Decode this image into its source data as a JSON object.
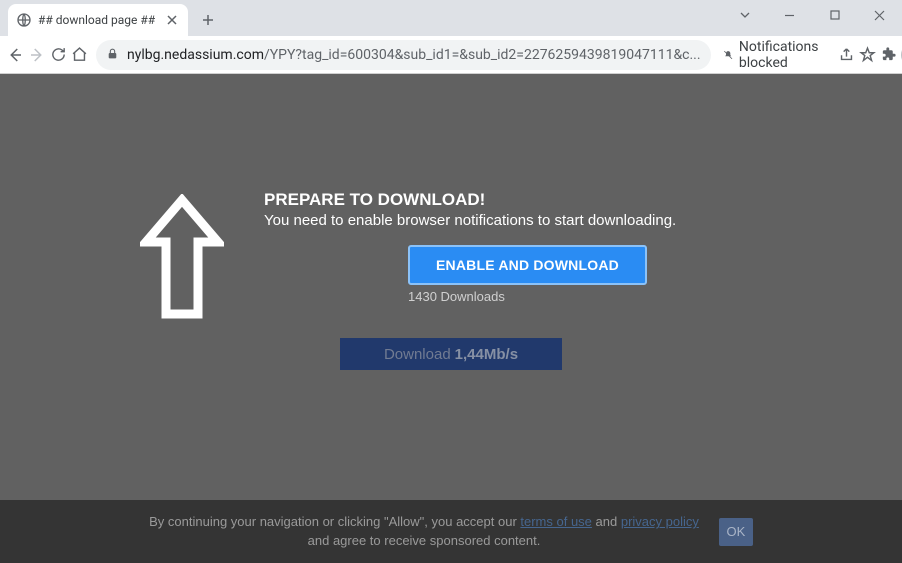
{
  "titlebar": {
    "tab_title": "## download page ##"
  },
  "toolbar": {
    "url_host": "nylbg.nedassium.com",
    "url_path": "/YPY?tag_id=600304&sub_id1=&sub_id2=2276259439819047111&c...",
    "notifications_label": "Notifications blocked"
  },
  "page": {
    "heading": "PREPARE TO DOWNLOAD!",
    "sub": "You need to enable browser notifications to start downloading.",
    "enable_button": "ENABLE AND DOWNLOAD",
    "downloads_count": "1430 Downloads",
    "download_label": "Download",
    "download_speed": "1,44Mb/s"
  },
  "bottom": {
    "line1_before": "By continuing your navigation or clicking \"Allow\", you accept our ",
    "terms_link": "terms of use",
    "line1_mid": " and ",
    "privacy_link": "privacy policy",
    "line2": "and agree to receive sponsored content.",
    "ok": "OK"
  }
}
